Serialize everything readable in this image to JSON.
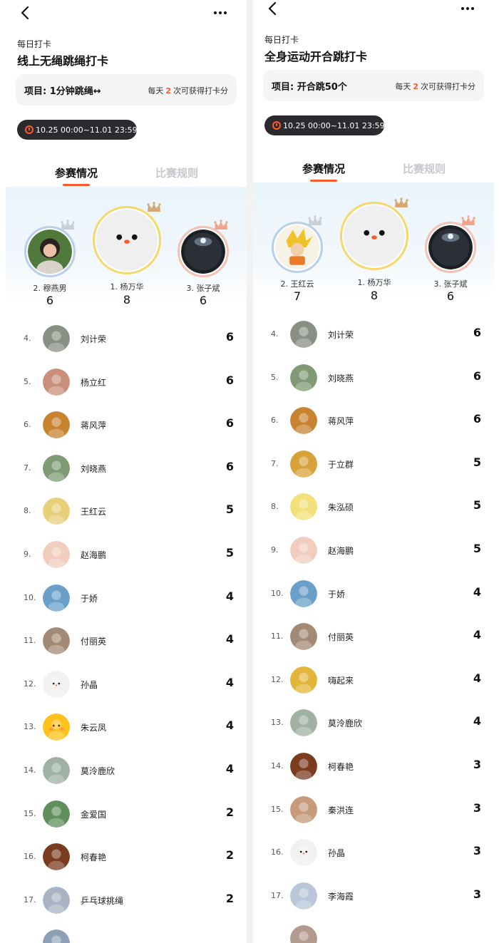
{
  "panels": [
    {
      "kicker": "每日打卡",
      "title": "线上无绳跳绳打卡",
      "project": "项目: 1分钟跳绳↔",
      "quota": {
        "prefix": "每天",
        "num": "2",
        "suffix": "次可获得打卡分"
      },
      "date_range": "10.25 00:00~11.01 23:59",
      "tabs": [
        "参赛情况",
        "比赛规则"
      ],
      "podium": [
        {
          "rank_name": "2. 穆燕男",
          "score": "6",
          "avatar": "photo-avatar-woman",
          "ring": "#b9cfe8",
          "crown": "#c9cfd6"
        },
        {
          "rank_name": "1. 杨万华",
          "score": "8",
          "avatar": "white-face-avatar",
          "ring": "#f5d86b",
          "crown": "#d6a673"
        },
        {
          "rank_name": "3. 张子斌",
          "score": "6",
          "avatar": "dark-orb-avatar",
          "ring": "#f3c2b2",
          "crown": "#f0a58a"
        }
      ],
      "rows": [
        {
          "rank": "4.",
          "name": "刘计荣",
          "score": "6",
          "avatar_color": "#8a8f84"
        },
        {
          "rank": "5.",
          "name": "杨立红",
          "score": "6",
          "avatar_color": "#c98f7a"
        },
        {
          "rank": "6.",
          "name": "蒋风萍",
          "score": "6",
          "avatar_color": "#c8832f"
        },
        {
          "rank": "7.",
          "name": "刘晓燕",
          "score": "6",
          "avatar_color": "#7f9a74"
        },
        {
          "rank": "8.",
          "name": "王红云",
          "score": "5",
          "avatar_color": "#e8cf7a"
        },
        {
          "rank": "9.",
          "name": "赵海鹏",
          "score": "5",
          "avatar_color": "#f0cdbd"
        },
        {
          "rank": "10.",
          "name": "于娇",
          "score": "4",
          "avatar_color": "#6a9fc9"
        },
        {
          "rank": "11.",
          "name": "付丽英",
          "score": "4",
          "avatar_color": "#a38a76"
        },
        {
          "rank": "12.",
          "name": "孙晶",
          "score": "4",
          "avatar_color": "#f1f1f1"
        },
        {
          "rank": "13.",
          "name": "朱云凤",
          "score": "4",
          "avatar_color": "#ffc21a"
        },
        {
          "rank": "14.",
          "name": "莫泠鹿欣",
          "score": "4",
          "avatar_color": "#9fb1a3"
        },
        {
          "rank": "15.",
          "name": "金爱国",
          "score": "2",
          "avatar_color": "#5f8f5c"
        },
        {
          "rank": "16.",
          "name": "柯春艳",
          "score": "2",
          "avatar_color": "#7a3b1f"
        },
        {
          "rank": "17.",
          "name": "乒乓球挑绳",
          "score": "2",
          "avatar_color": "#a9b3c4"
        },
        {
          "rank": "",
          "name": "",
          "score": "",
          "avatar_color": "#8ea0b6"
        }
      ]
    },
    {
      "kicker": "每日打卡",
      "title": "全身运动开合跳打卡",
      "project": "项目: 开合跳50个",
      "quota": {
        "prefix": "每天",
        "num": "2",
        "suffix": "次可获得打卡分"
      },
      "date_range": "10.25 00:00~11.01 23:59",
      "tabs": [
        "参赛情况",
        "比赛规则"
      ],
      "podium": [
        {
          "rank_name": "2. 王红云",
          "score": "7",
          "avatar": "cartoon-avatar",
          "ring": "#b9cfe8",
          "crown": "#c9cfd6"
        },
        {
          "rank_name": "1. 杨万华",
          "score": "8",
          "avatar": "white-face-avatar",
          "ring": "#f5d86b",
          "crown": "#d6a673"
        },
        {
          "rank_name": "3. 张子斌",
          "score": "6",
          "avatar": "dark-orb-avatar",
          "ring": "#f3c2b2",
          "crown": "#f0a58a"
        }
      ],
      "rows": [
        {
          "rank": "4.",
          "name": "刘计荣",
          "score": "6",
          "avatar_color": "#8a8f84"
        },
        {
          "rank": "5.",
          "name": "刘晓燕",
          "score": "6",
          "avatar_color": "#7f9a74"
        },
        {
          "rank": "6.",
          "name": "蒋风萍",
          "score": "6",
          "avatar_color": "#c8832f"
        },
        {
          "rank": "7.",
          "name": "于立群",
          "score": "5",
          "avatar_color": "#d8a23a"
        },
        {
          "rank": "8.",
          "name": "朱泓硕",
          "score": "5",
          "avatar_color": "#f2e07a"
        },
        {
          "rank": "9.",
          "name": "赵海鹏",
          "score": "5",
          "avatar_color": "#f0cdbd"
        },
        {
          "rank": "10.",
          "name": "于娇",
          "score": "4",
          "avatar_color": "#6a9fc9"
        },
        {
          "rank": "11.",
          "name": "付丽英",
          "score": "4",
          "avatar_color": "#a38a76"
        },
        {
          "rank": "12.",
          "name": "嗨起来",
          "score": "4",
          "avatar_color": "#e3b63a"
        },
        {
          "rank": "13.",
          "name": "莫泠鹿欣",
          "score": "4",
          "avatar_color": "#9fb1a3"
        },
        {
          "rank": "14.",
          "name": "柯春艳",
          "score": "3",
          "avatar_color": "#7a3b1f"
        },
        {
          "rank": "15.",
          "name": "秦洪连",
          "score": "3",
          "avatar_color": "#c69a7a"
        },
        {
          "rank": "16.",
          "name": "孙晶",
          "score": "3",
          "avatar_color": "#f1f1f1"
        },
        {
          "rank": "17.",
          "name": "李海霞",
          "score": "3",
          "avatar_color": "#b7c6d8"
        },
        {
          "rank": "",
          "name": "",
          "score": "",
          "avatar_color": "#b29a8e"
        }
      ]
    }
  ]
}
